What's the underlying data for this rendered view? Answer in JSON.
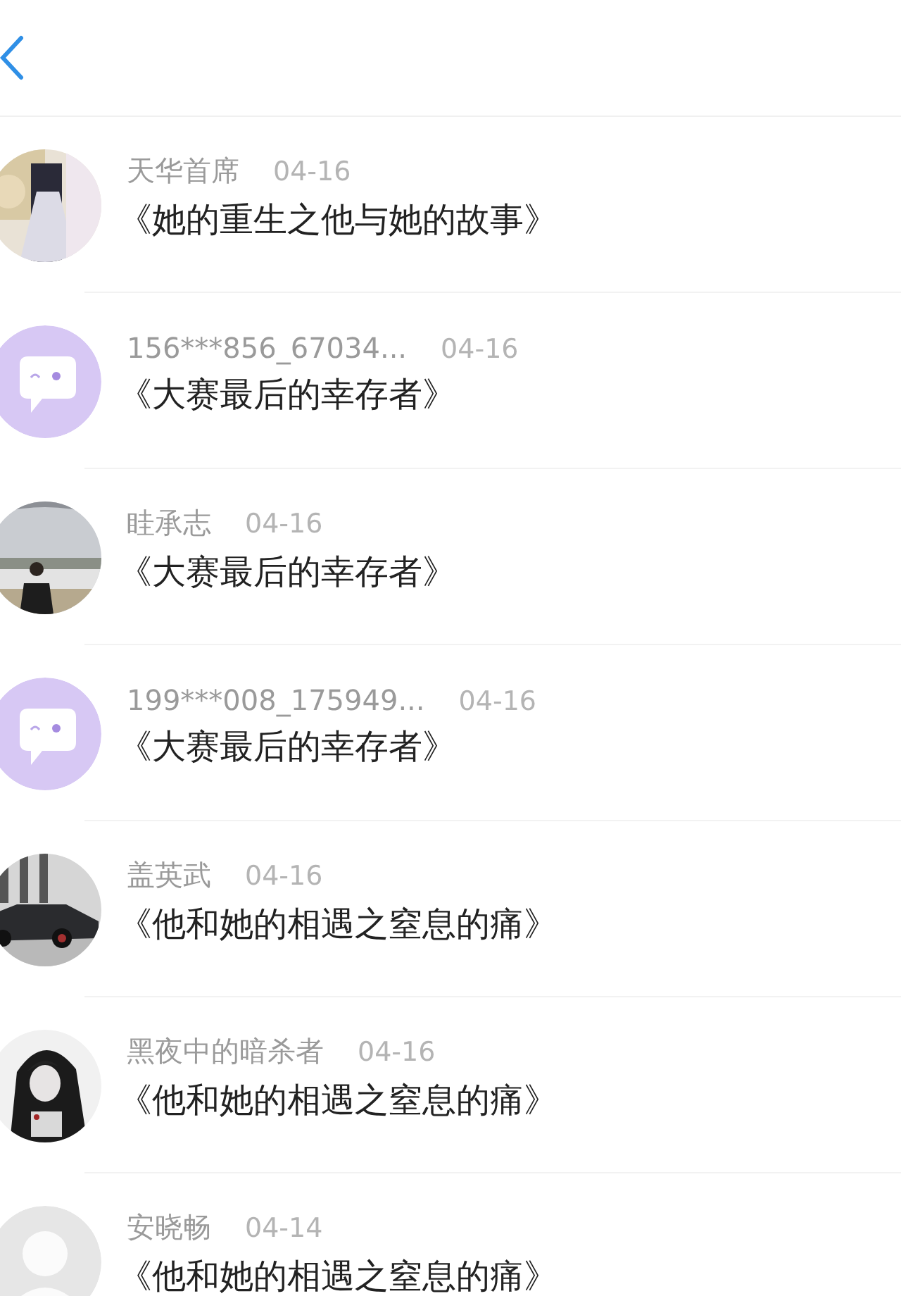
{
  "comments": [
    {
      "name": "天华首席",
      "date": "04-16",
      "title": "《她的重生之他与她的故事》"
    },
    {
      "avatar": {
        "kind": "bubble"
      },
      "name": "156***856_67034...",
      "date": "04-16",
      "title": "《大赛最后的幸存者》"
    },
    {
      "name": "眭承志",
      "date": "04-16",
      "title": "《大赛最后的幸存者》"
    },
    {
      "avatar": {
        "kind": "bubble"
      },
      "name": "199***008_175949...",
      "date": "04-16",
      "title": "《大赛最后的幸存者》"
    },
    {
      "name": "盖英武",
      "date": "04-16",
      "title": "《他和她的相遇之窒息的痛》"
    },
    {
      "name": "黑夜中的暗杀者",
      "date": "04-16",
      "title": "《他和她的相遇之窒息的痛》"
    },
    {
      "avatar": {
        "kind": "default"
      },
      "name": "安晓畅",
      "date": "04-14",
      "title": "《他和她的相遇之窒息的痛》"
    }
  ]
}
